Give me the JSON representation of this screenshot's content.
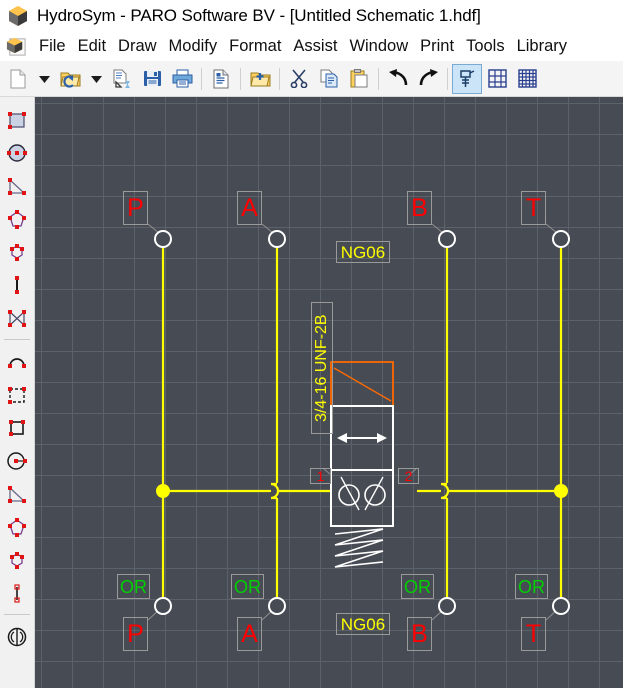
{
  "window": {
    "title": "HydroSym - PARO Software BV - [Untitled Schematic 1.hdf]",
    "logo_icon": "hydrosym-hex-logo-icon"
  },
  "menubar": {
    "app_icon": "hydrosym-hex-logo-icon",
    "items": [
      {
        "label": "File",
        "name": "menu-file"
      },
      {
        "label": "Edit",
        "name": "menu-edit"
      },
      {
        "label": "Draw",
        "name": "menu-draw"
      },
      {
        "label": "Modify",
        "name": "menu-modify"
      },
      {
        "label": "Format",
        "name": "menu-format"
      },
      {
        "label": "Assist",
        "name": "menu-assist"
      },
      {
        "label": "Window",
        "name": "menu-window"
      },
      {
        "label": "Print",
        "name": "menu-print"
      },
      {
        "label": "Tools",
        "name": "menu-tools"
      },
      {
        "label": "Library",
        "name": "menu-library"
      }
    ]
  },
  "toolbar": {
    "buttons": [
      {
        "icon": "new-document-icon",
        "tooltip": "New"
      },
      {
        "icon": "chevron-down-icon",
        "tooltip": "New options"
      },
      {
        "icon": "open-folder-icon",
        "tooltip": "Open"
      },
      {
        "icon": "chevron-down-icon",
        "tooltip": "Open options"
      },
      {
        "icon": "import-document-icon",
        "tooltip": "Import"
      },
      {
        "icon": "save-floppy-icon",
        "tooltip": "Save"
      },
      {
        "icon": "print-icon",
        "tooltip": "Print"
      },
      {
        "icon": "document-properties-icon",
        "tooltip": "Properties"
      },
      {
        "icon": "open-add-folder-icon",
        "tooltip": "Add to project"
      },
      {
        "icon": "cut-scissors-icon",
        "tooltip": "Cut"
      },
      {
        "icon": "copy-icon",
        "tooltip": "Copy"
      },
      {
        "icon": "paste-icon",
        "tooltip": "Paste"
      },
      {
        "icon": "undo-arrow-icon",
        "tooltip": "Undo"
      },
      {
        "icon": "redo-arrow-icon",
        "tooltip": "Redo"
      },
      {
        "icon": "snap-tool-icon",
        "tooltip": "Snap",
        "active": true
      },
      {
        "icon": "grid-coarse-icon",
        "tooltip": "Coarse grid"
      },
      {
        "icon": "grid-fine-icon",
        "tooltip": "Fine grid"
      }
    ]
  },
  "left_rail": {
    "tools": [
      {
        "icon": "rectangle-tool-icon"
      },
      {
        "icon": "circle-tool-icon"
      },
      {
        "icon": "triangle-tool-icon"
      },
      {
        "icon": "polygon-5-tool-icon"
      },
      {
        "icon": "polygon-6-tool-icon"
      },
      {
        "icon": "line-vertical-tool-icon"
      },
      {
        "icon": "bowtie-tool-icon"
      },
      {
        "icon": "arc-tool-icon"
      },
      {
        "icon": "dashed-rectangle-tool-icon"
      },
      {
        "icon": "square-tool-icon"
      },
      {
        "icon": "circle-radius-tool-icon"
      },
      {
        "icon": "right-triangle-tool-icon"
      },
      {
        "icon": "polygon-5b-tool-icon"
      },
      {
        "icon": "polygon-6b-tool-icon"
      },
      {
        "icon": "segment-tool-icon"
      },
      {
        "icon": "mirror-tool-icon"
      }
    ]
  },
  "canvas": {
    "background_color": "#474b54",
    "grid_color": "#5d616a",
    "grid_spacing": 31,
    "wire_color": "#ffff00",
    "symbol_color": "#ffffff",
    "solenoid_color": "#ff6a00",
    "port_labels_top": [
      {
        "text": "P",
        "name": "port-label-p-top"
      },
      {
        "text": "A",
        "name": "port-label-a-top"
      },
      {
        "text": "B",
        "name": "port-label-b-top"
      },
      {
        "text": "T",
        "name": "port-label-t-top"
      }
    ],
    "port_labels_bottom": [
      {
        "text": "P",
        "name": "port-label-p-bottom"
      },
      {
        "text": "A",
        "name": "port-label-a-bottom"
      },
      {
        "text": "B",
        "name": "port-label-b-bottom"
      },
      {
        "text": "T",
        "name": "port-label-t-bottom"
      }
    ],
    "or_labels": [
      {
        "text": "OR",
        "name": "or-label-p"
      },
      {
        "text": "OR",
        "name": "or-label-a"
      },
      {
        "text": "OR",
        "name": "or-label-b"
      },
      {
        "text": "OR",
        "name": "or-label-t"
      }
    ],
    "size_label_top": "NG06",
    "size_label_bottom": "NG06",
    "thread_label": "3/4-16 UNF-2B",
    "valve_port_1": "1",
    "valve_port_2": "2"
  }
}
